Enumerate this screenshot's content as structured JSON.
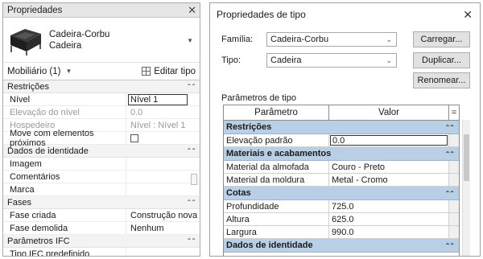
{
  "properties_palette": {
    "title": "Propriedades",
    "type_family": "Cadeira-Corbu",
    "type_name": "Cadeira",
    "instance_filter": "Mobiliário (1)",
    "edit_type_label": "Editar tipo",
    "groups": [
      {
        "label": "Restrições",
        "rows": [
          {
            "name": "Nível",
            "value": "Nível 1"
          },
          {
            "name": "Elevação do nível",
            "value": "0.0"
          },
          {
            "name": "Hospedeiro",
            "value": "Nível : Nível 1"
          },
          {
            "name": "Move com elementos próximos",
            "value": ""
          }
        ]
      },
      {
        "label": "Dados de identidade",
        "rows": [
          {
            "name": "Imagem",
            "value": ""
          },
          {
            "name": "Comentários",
            "value": ""
          },
          {
            "name": "Marca",
            "value": ""
          }
        ]
      },
      {
        "label": "Fases",
        "rows": [
          {
            "name": "Fase criada",
            "value": "Construção nova"
          },
          {
            "name": "Fase demolida",
            "value": "Nenhum"
          }
        ]
      },
      {
        "label": "Parâmetros IFC",
        "rows": [
          {
            "name": "Tipo IFC predefinido",
            "value": ""
          }
        ]
      }
    ]
  },
  "type_dialog": {
    "title": "Propriedades de tipo",
    "family_label": "Família:",
    "family_value": "Cadeira-Corbu",
    "type_label": "Tipo:",
    "type_value": "Cadeira",
    "load_button": "Carregar...",
    "duplicate_button": "Duplicar...",
    "rename_button": "Renomear...",
    "params_label": "Parâmetros de tipo",
    "col_param": "Parâmetro",
    "col_value": "Valor",
    "col_eq": "=",
    "sections": [
      {
        "label": "Restrições",
        "rows": [
          {
            "name": "Elevação padrão",
            "value": "0.0"
          }
        ]
      },
      {
        "label": "Materiais e acabamentos",
        "rows": [
          {
            "name": "Material da almofada",
            "value": "Couro - Preto"
          },
          {
            "name": "Material da moldura",
            "value": "Metal - Cromo"
          }
        ]
      },
      {
        "label": "Cotas",
        "rows": [
          {
            "name": "Profundidade",
            "value": "725.0"
          },
          {
            "name": "Altura",
            "value": "625.0"
          },
          {
            "name": "Largura",
            "value": "990.0"
          }
        ]
      },
      {
        "label": "Dados de identidade",
        "rows": []
      }
    ]
  },
  "icons": [
    "close-icon",
    "chair-thumbnail-icon",
    "edit-type-icon",
    "collapse-icon",
    "dropdown-caret-icon",
    "checkbox-icon"
  ],
  "colors": {
    "section_header": "#b9cfe6",
    "group_header": "#f3f3f3",
    "title_bar": "#e6e6e6"
  }
}
